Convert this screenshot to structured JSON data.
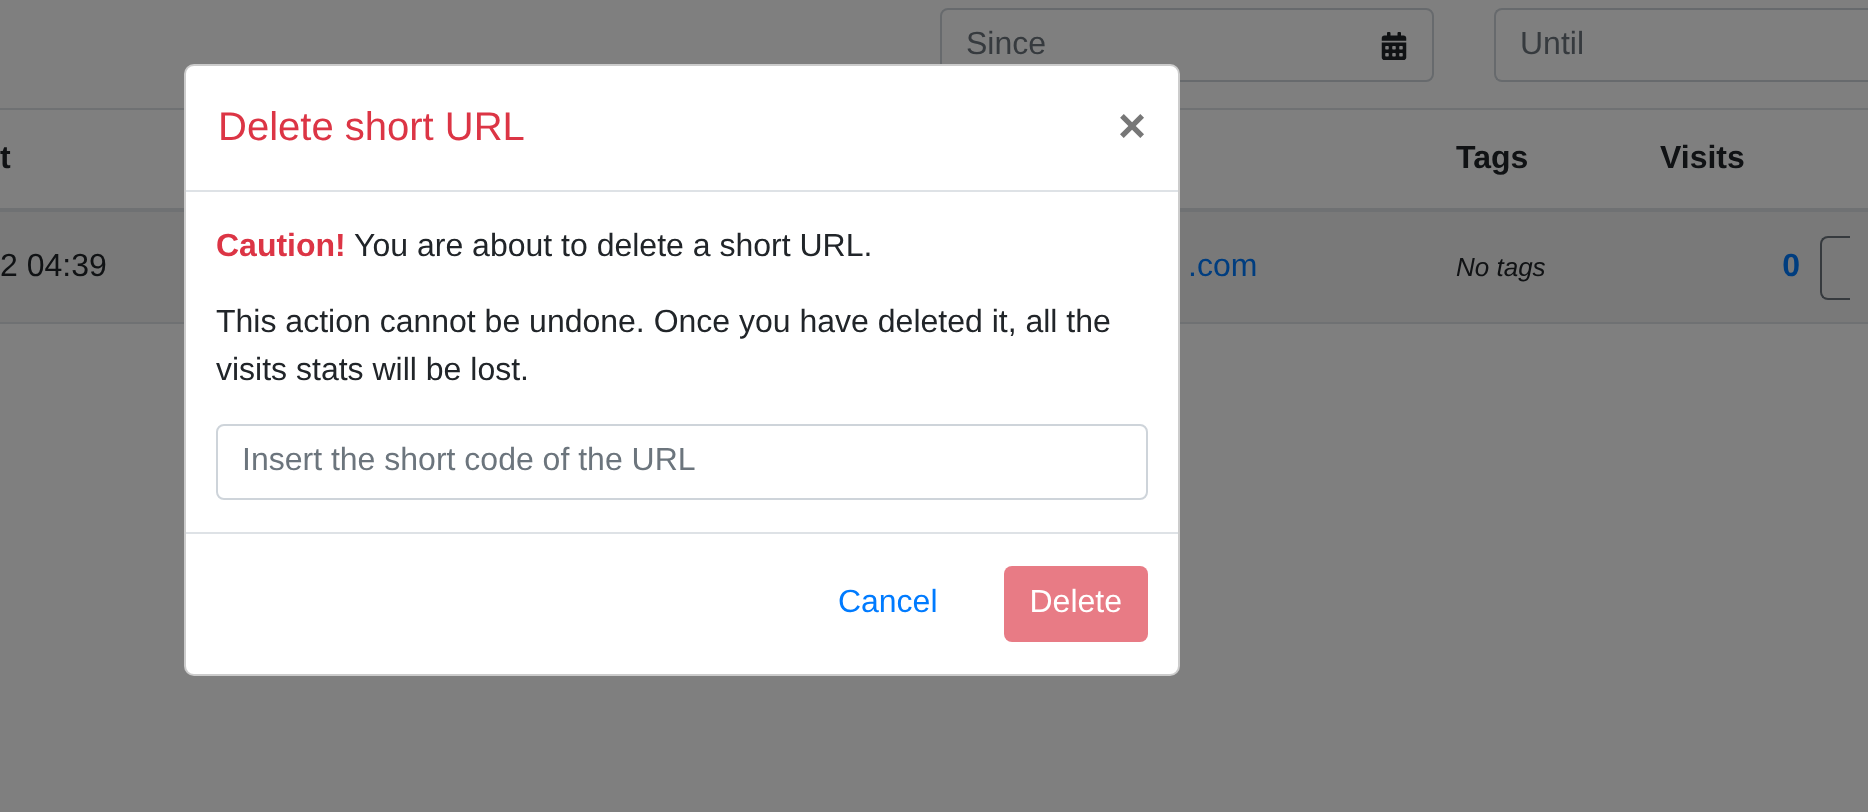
{
  "filters": [
    {
      "placeholder": "Since",
      "kind": "date"
    },
    {
      "placeholder": "Until",
      "kind": "text"
    }
  ],
  "table": {
    "header": {
      "date": "t",
      "tags": "Tags",
      "visits": "Visits"
    },
    "rows": [
      {
        "date": "2 04:39",
        "long_url": ".com",
        "tags": "No tags",
        "visits": "0"
      }
    ]
  },
  "modal": {
    "title": "Delete short URL",
    "close": "×",
    "warning": "**Caution!** You are about to delete a short URL.",
    "note": "This action cannot be undone. Once you have deleted it, all the visits stats will be lost.",
    "input": {
      "placeholder": "Insert the short code of the URL"
    },
    "buttons": [
      {
        "label": "Cancel",
        "kind": "link",
        "disabled": false
      },
      {
        "label": "Delete",
        "kind": "danger",
        "disabled": true
      }
    ]
  }
}
